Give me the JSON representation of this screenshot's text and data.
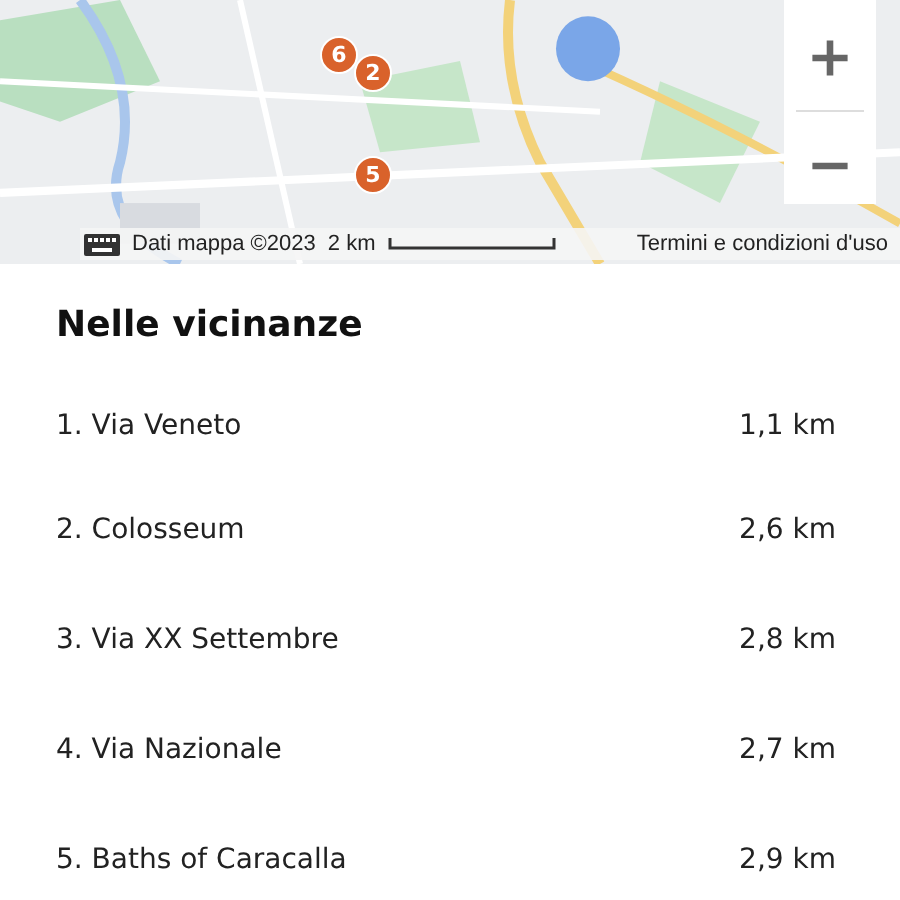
{
  "map": {
    "pins": [
      {
        "label": "6"
      },
      {
        "label": "2"
      },
      {
        "label": "5"
      }
    ],
    "attribution": {
      "data": "Dati mappa ©2023",
      "scale": "2 km",
      "terms": "Termini e condizioni d'uso"
    }
  },
  "nearby": {
    "title": "Nelle vicinanze",
    "items": [
      {
        "name": "1. Via Veneto",
        "distance": "1,1 km"
      },
      {
        "name": "2. Colosseum",
        "distance": "2,6 km"
      },
      {
        "name": "3. Via XX Settembre",
        "distance": "2,8 km"
      },
      {
        "name": "4. Via Nazionale",
        "distance": "2,7 km"
      },
      {
        "name": "5. Baths of Caracalla",
        "distance": "2,9 km"
      }
    ]
  }
}
